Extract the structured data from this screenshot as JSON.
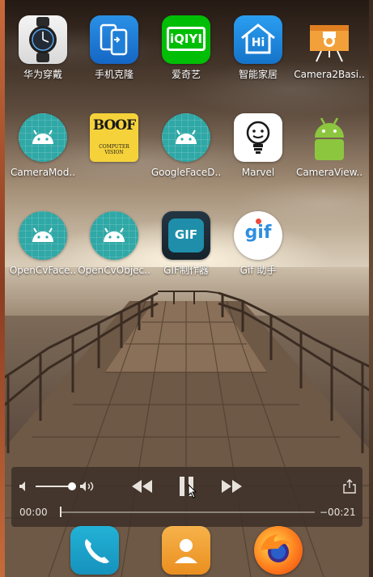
{
  "apps": [
    {
      "label": "华为穿戴",
      "icon": "huawei-wear-icon"
    },
    {
      "label": "手机克隆",
      "icon": "phone-clone-icon"
    },
    {
      "label": "爱奇艺",
      "icon": "iqiyi-icon"
    },
    {
      "label": "智能家居",
      "icon": "smart-home-icon"
    },
    {
      "label": "Camera2Basi..",
      "icon": "camera2basic-icon"
    },
    {
      "label": "CameraMod..",
      "icon": "android-icon"
    },
    {
      "label": "",
      "icon": "boof-cv-icon"
    },
    {
      "label": "GoogleFaceD..",
      "icon": "android-icon"
    },
    {
      "label": "Marvel",
      "icon": "marvel-bulb-icon"
    },
    {
      "label": "CameraView..",
      "icon": "android-icon"
    },
    {
      "label": "OpenCvFace..",
      "icon": "android-icon"
    },
    {
      "label": "OpenCvObjec..",
      "icon": "android-icon"
    },
    {
      "label": "GIF制作器",
      "icon": "gif-maker-icon"
    },
    {
      "label": "Gif 助手",
      "icon": "gif-helper-icon"
    }
  ],
  "icon_text": {
    "iqiyi": "iQIYI",
    "smart_home": "Hi",
    "boof": "BOOF",
    "boof_sub": "COMPUTER VISION",
    "gif_maker": "GIF",
    "gif_helper": "gif"
  },
  "media": {
    "elapsed": "00:00",
    "remaining": "−00:21",
    "progress": 0.0,
    "volume": 0.9
  },
  "dock": [
    {
      "icon": "phone-icon"
    },
    {
      "icon": "contacts-icon"
    },
    {
      "icon": "firefox-icon"
    }
  ],
  "colors": {
    "android_teal": "#2fa8a6",
    "iqiyi_green": "#00be06",
    "smart_home_blue": "#1d8fe1",
    "phone_clone_blue": "#1f7fd6",
    "firefox_orange": "#ff7f1f"
  }
}
